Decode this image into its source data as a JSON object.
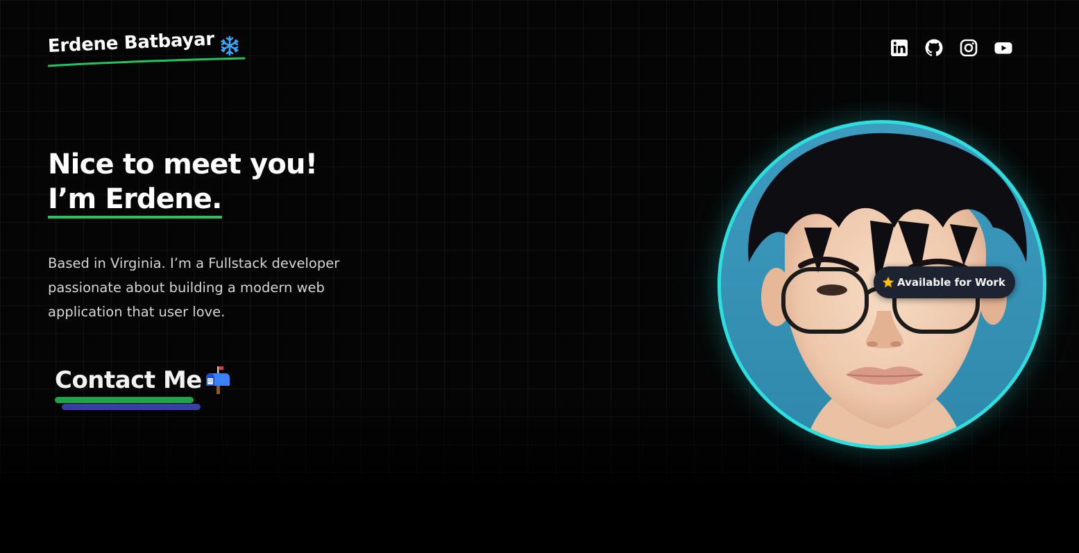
{
  "header": {
    "logo_text": "Erdene Batbayar",
    "logo_emoji_icon": "snowflake-icon",
    "socials": [
      {
        "name": "LinkedIn",
        "icon": "linkedin-icon"
      },
      {
        "name": "GitHub",
        "icon": "github-icon"
      },
      {
        "name": "Instagram",
        "icon": "instagram-icon"
      },
      {
        "name": "YouTube",
        "icon": "youtube-icon"
      }
    ]
  },
  "hero": {
    "title_line1": "Nice to meet you!",
    "title_line2": "I’m Erdene.",
    "bio": "Based in Virginia. I’m a Fullstack developer passionate about building a modern web application that user love.",
    "contact_label": "Contact Me",
    "contact_icon": "mailbox-icon"
  },
  "avatar": {
    "badge_label": "Available for Work",
    "badge_icon": "star-icon"
  },
  "colors": {
    "background": "#000000",
    "accent_green": "#22c55e",
    "accent_blue": "#3b3fa3",
    "avatar_ring": "#2de0e0",
    "badge_bg": "#1d2330"
  }
}
